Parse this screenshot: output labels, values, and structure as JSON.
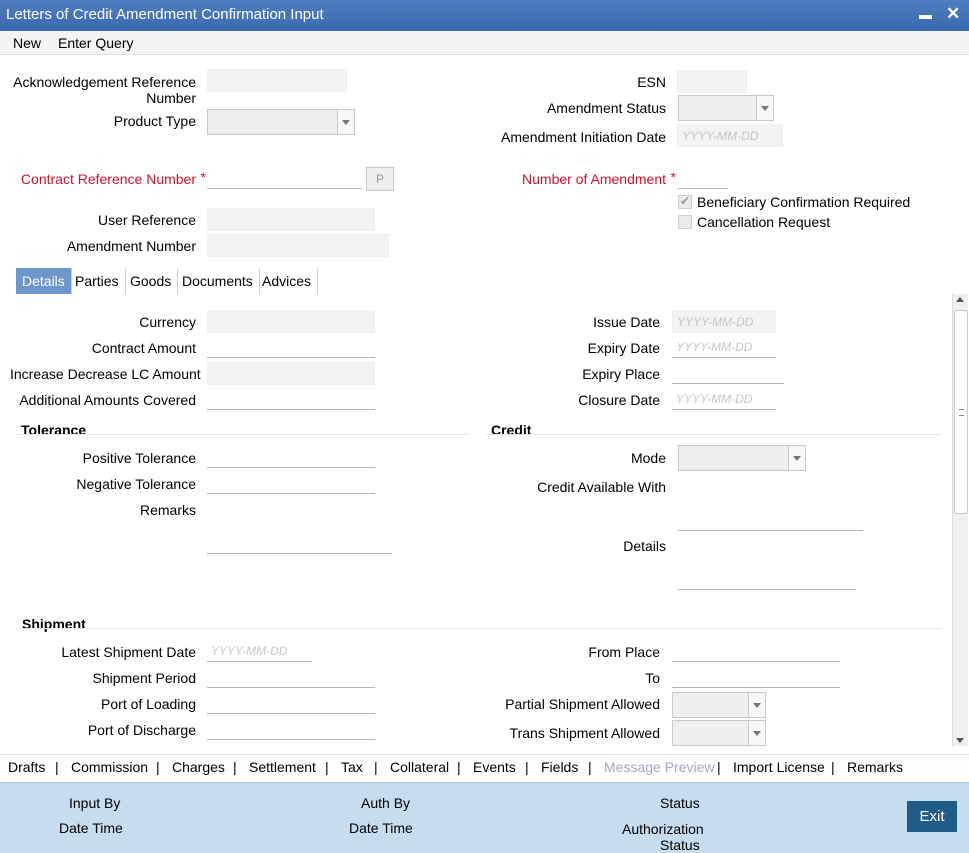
{
  "window": {
    "title": "Letters of Credit Amendment Confirmation Input",
    "minimize": "▬",
    "close": "✕"
  },
  "menu": {
    "new": "New",
    "enter_query": "Enter Query"
  },
  "header": {
    "ack_ref_1": "Acknowledgement Reference",
    "ack_ref_2": "Number",
    "product_type": "Product Type",
    "contract_ref": "Contract Reference Number",
    "p_button": "P",
    "user_reference": "User Reference",
    "amendment_number": "Amendment Number",
    "esn": "ESN",
    "amendment_status": "Amendment Status",
    "amendment_init_date": "Amendment Initiation Date",
    "date_placeholder": "YYYY-MM-DD",
    "number_of_amendment": "Number of Amendment",
    "required_mark": "*",
    "beneficiary_conf": "Beneficiary Confirmation Required",
    "beneficiary_conf_checked": true,
    "cancellation_request": "Cancellation Request",
    "cancellation_request_checked": false
  },
  "tabs": [
    "Details",
    "Parties",
    "Goods",
    "Documents",
    "Advices"
  ],
  "details": {
    "currency": "Currency",
    "contract_amount": "Contract Amount",
    "increase_decrease": "Increase Decrease LC Amount",
    "additional_amounts": "Additional Amounts Covered",
    "issue_date": "Issue Date",
    "expiry_date": "Expiry Date",
    "expiry_place": "Expiry Place",
    "closure_date": "Closure Date",
    "tolerance_title": "Tolerance",
    "positive_tolerance": "Positive Tolerance",
    "negative_tolerance": "Negative Tolerance",
    "remarks": "Remarks",
    "credit_title": "Credit",
    "mode": "Mode",
    "credit_available_with": "Credit Available With",
    "credit_details": "Details",
    "shipment_title": "Shipment",
    "latest_shipment_date": "Latest Shipment Date",
    "shipment_period": "Shipment Period",
    "port_of_loading": "Port of Loading",
    "port_of_discharge": "Port of Discharge",
    "from_place": "From Place",
    "to": "To",
    "partial_shipment": "Partial Shipment Allowed",
    "trans_shipment": "Trans Shipment Allowed"
  },
  "bottom_links": {
    "drafts": "Drafts",
    "commission": "Commission",
    "charges": "Charges",
    "settlement": "Settlement",
    "tax": "Tax",
    "collateral": "Collateral",
    "events": "Events",
    "fields": "Fields",
    "message_preview": "Message Preview",
    "import_license": "Import License",
    "remarks": "Remarks",
    "separator": "|"
  },
  "footer": {
    "input_by": "Input By",
    "date_time": "Date Time",
    "auth_by": "Auth By",
    "auth_date_time": "Date Time",
    "status": "Status",
    "authorization": "Authorization",
    "auth_status": "Status",
    "exit": "Exit"
  }
}
